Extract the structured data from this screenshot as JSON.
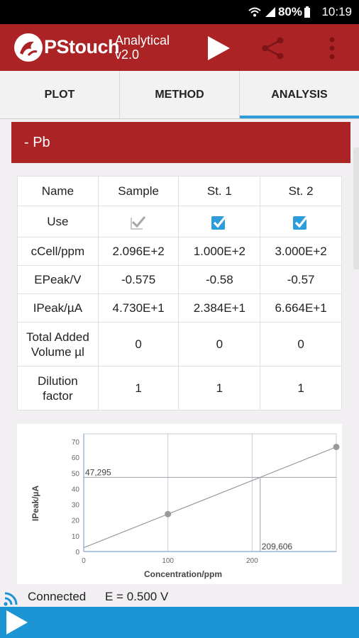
{
  "status_bar": {
    "battery": "80%",
    "time": "10:19"
  },
  "app": {
    "brand": "PStouch",
    "subtitle_line1": "Analytical",
    "subtitle_line2": "v2.0"
  },
  "tabs": [
    {
      "label": "PLOT",
      "active": false
    },
    {
      "label": "METHOD",
      "active": false
    },
    {
      "label": "ANALYSIS",
      "active": true
    }
  ],
  "section": {
    "title": "- Pb"
  },
  "table": {
    "headers": [
      "Name",
      "Sample",
      "St. 1",
      "St. 2"
    ],
    "use": {
      "label": "Use",
      "sample_checked": true,
      "sample_enabled": false,
      "st1_checked": true,
      "st2_checked": true
    },
    "rows": [
      {
        "label": "cCell/ppm",
        "values": [
          "2.096E+2",
          "1.000E+2",
          "3.000E+2"
        ]
      },
      {
        "label": "EPeak/V",
        "values": [
          "-0.575",
          "-0.58",
          "-0.57"
        ]
      },
      {
        "label": "IPeak/µA",
        "values": [
          "4.730E+1",
          "2.384E+1",
          "6.664E+1"
        ]
      },
      {
        "label_line1": "Total Added",
        "label_line2": "Volume µl",
        "values": [
          "0",
          "0",
          "0"
        ]
      },
      {
        "label_line1": "Dilution",
        "label_line2": "factor",
        "values": [
          "1",
          "1",
          "1"
        ]
      }
    ]
  },
  "chart_data": {
    "type": "scatter",
    "xlabel": "Concentration/ppm",
    "ylabel": "IPeak/µA",
    "xlim": [
      0,
      300
    ],
    "ylim": [
      0,
      75
    ],
    "xticks": [
      0,
      100,
      200
    ],
    "yticks": [
      0,
      10,
      20,
      30,
      40,
      50,
      60,
      70
    ],
    "points": [
      {
        "x": 100,
        "y": 23.84
      },
      {
        "x": 300,
        "y": 66.64
      }
    ],
    "fit_line": {
      "x": [
        0,
        300
      ],
      "y": [
        2.44,
        66.64
      ]
    },
    "sample_marker": {
      "x": 209.606,
      "y": 47.295,
      "x_label": "209,606",
      "y_label": "47,295"
    },
    "colors": {
      "grid": "#c8ccd4",
      "fit": "#9a9a9a",
      "point": "#9a9a9a",
      "marker": "#9aa0a8"
    }
  },
  "connection": {
    "status": "Connected",
    "potential": "E = 0.500 V"
  },
  "colors": {
    "appbar": "#ab2325",
    "accent": "#2d9cdb",
    "bottombar": "#1c95d4"
  }
}
